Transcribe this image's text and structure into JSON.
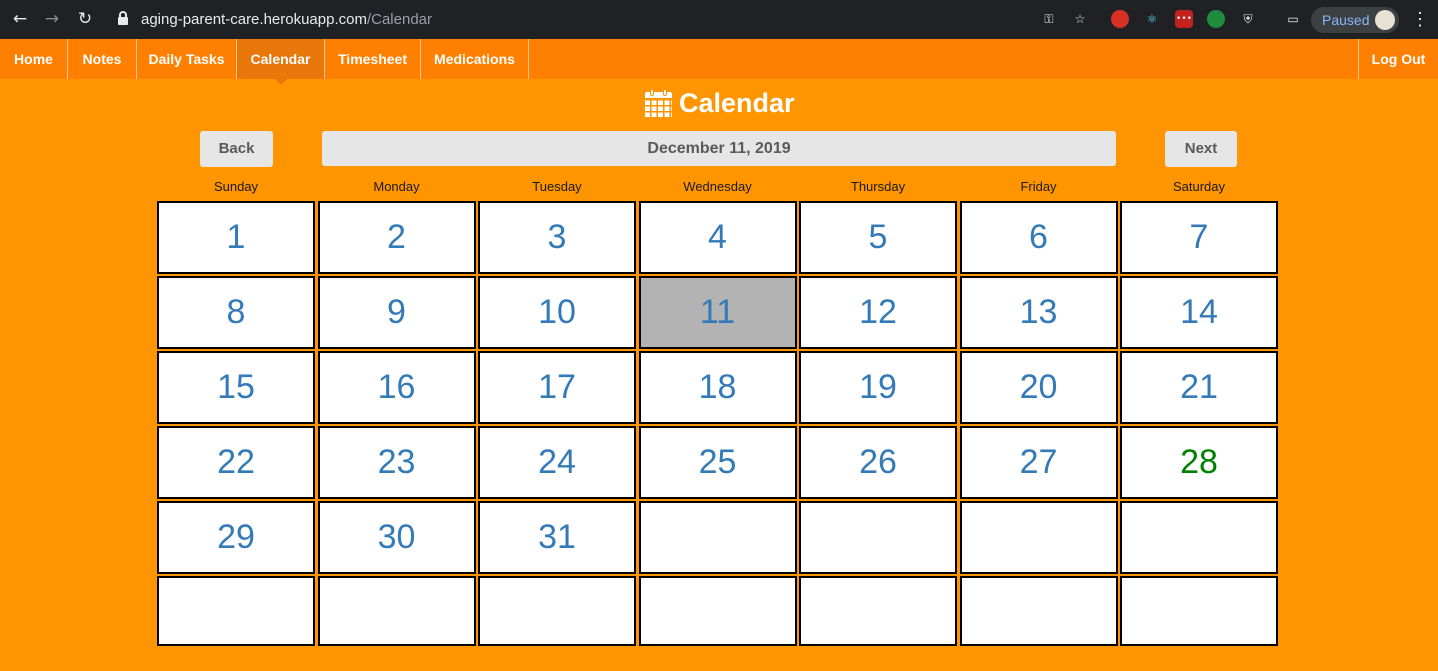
{
  "browser": {
    "url_host": "aging-parent-care.herokuapp.com",
    "url_path": "/Calendar",
    "profile_status": "Paused"
  },
  "nav": {
    "items": [
      {
        "label": "Home",
        "active": false
      },
      {
        "label": "Notes",
        "active": false
      },
      {
        "label": "Daily Tasks",
        "active": false
      },
      {
        "label": "Calendar",
        "active": true
      },
      {
        "label": "Timesheet",
        "active": false
      },
      {
        "label": "Medications",
        "active": false
      }
    ],
    "logout_label": "Log Out"
  },
  "page": {
    "title": "Calendar",
    "back_label": "Back",
    "next_label": "Next",
    "current_date": "December 11, 2019"
  },
  "calendar": {
    "weekdays": [
      "Sunday",
      "Monday",
      "Tuesday",
      "Wednesday",
      "Thursday",
      "Friday",
      "Saturday"
    ],
    "weeks": [
      [
        "1",
        "2",
        "3",
        "4",
        "5",
        "6",
        "7"
      ],
      [
        "8",
        "9",
        "10",
        "11",
        "12",
        "13",
        "14"
      ],
      [
        "15",
        "16",
        "17",
        "18",
        "19",
        "20",
        "21"
      ],
      [
        "22",
        "23",
        "24",
        "25",
        "26",
        "27",
        "28"
      ],
      [
        "29",
        "30",
        "31",
        "",
        "",
        "",
        ""
      ],
      [
        "",
        "",
        "",
        "",
        "",
        "",
        ""
      ]
    ],
    "selected_day": "11",
    "highlighted_day": "28",
    "colors": {
      "day_number": "#337ab7",
      "highlighted_day": "#008000",
      "selected_background": "#b3b3b3",
      "page_background": "#ff9500",
      "nav_background": "#ff7f00"
    }
  }
}
